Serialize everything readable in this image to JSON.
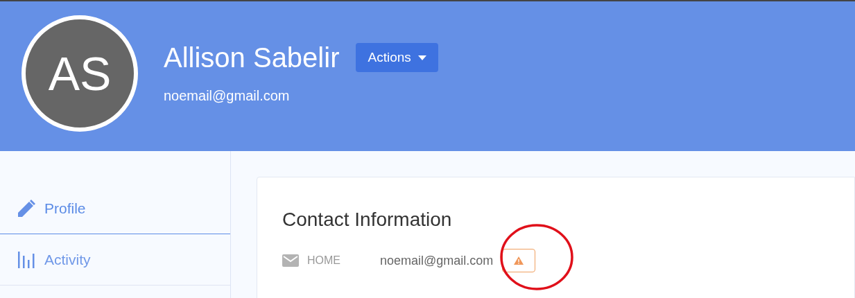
{
  "header": {
    "initials": "AS",
    "name": "Allison Sabelir",
    "email": "noemail@gmail.com",
    "actions_button": "Actions"
  },
  "sidebar": {
    "items": [
      {
        "label": "Profile",
        "kind": "pencil",
        "selected": true
      },
      {
        "label": "Activity",
        "kind": "bars",
        "selected": false
      }
    ]
  },
  "contact": {
    "title": "Contact Information",
    "rows": [
      {
        "kind": "email",
        "label": "HOME",
        "value": "noemail@gmail.com",
        "warning": true
      }
    ]
  },
  "annotation": {
    "kind": "circle"
  }
}
